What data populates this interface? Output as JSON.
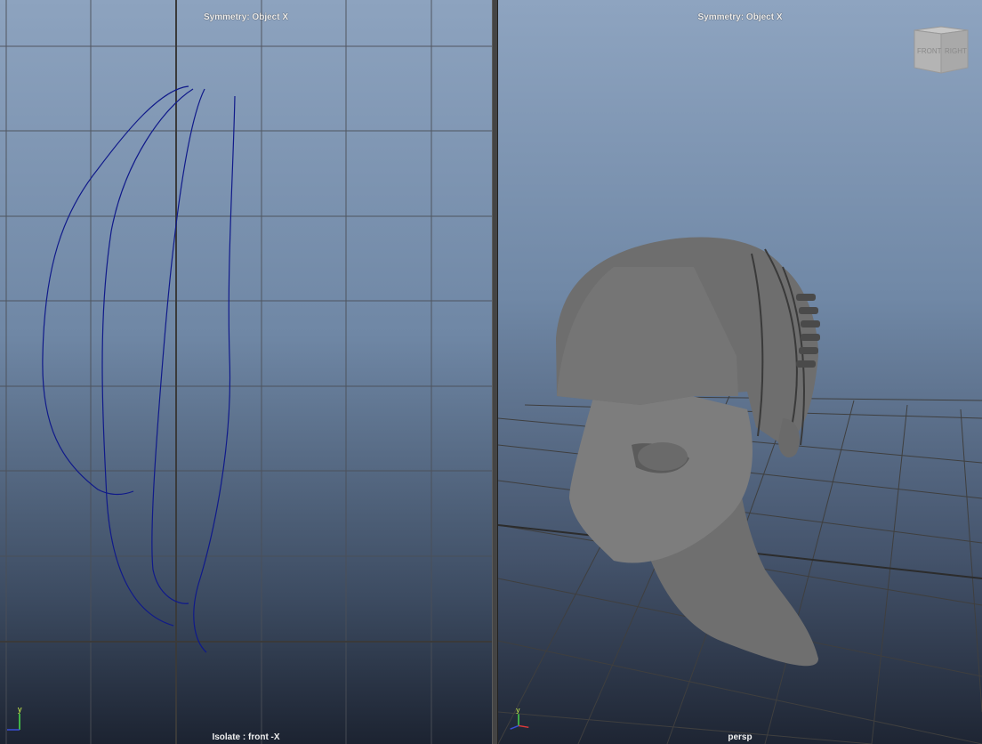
{
  "front_view": {
    "title": "Symmetry: Object X",
    "label": "Isolate : front -X",
    "axis_labels": {
      "y": "y",
      "x": "x"
    }
  },
  "persp_view": {
    "title": "Symmetry: Object X",
    "label": "persp",
    "viewcube": {
      "front": "FRONT",
      "right": "RIGHT"
    },
    "axis_labels": {
      "y": "y",
      "x": "x"
    }
  },
  "colors": {
    "curve": "#101a8a",
    "grid": "#4a4a4a",
    "mesh": "#7a7a7a"
  }
}
